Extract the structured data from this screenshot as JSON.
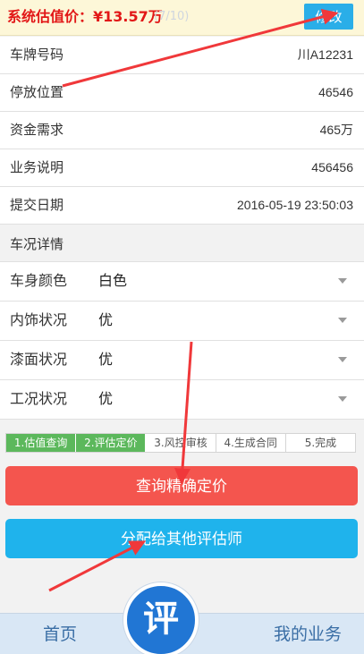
{
  "header": {
    "price_label": "系统估值价：¥13.57万",
    "hint_text": "(7/10)",
    "edit_button": "修改"
  },
  "info": [
    {
      "label": "车牌号码",
      "value": "川A12231"
    },
    {
      "label": "停放位置",
      "value": "46546"
    },
    {
      "label": "资金需求",
      "value": "465万"
    },
    {
      "label": "业务说明",
      "value": "456456"
    },
    {
      "label": "提交日期",
      "value": "2016-05-19 23:50:03"
    }
  ],
  "section": {
    "title": "车况详情"
  },
  "selects": [
    {
      "label": "车身颜色",
      "selected": "白色"
    },
    {
      "label": "内饰状况",
      "selected": "优"
    },
    {
      "label": "漆面状况",
      "selected": "优"
    },
    {
      "label": "工况状况",
      "selected": "优"
    }
  ],
  "steps": [
    {
      "label": "1.估值查询",
      "status": "done"
    },
    {
      "label": "2.评估定价",
      "status": "done"
    },
    {
      "label": "3.风控审核",
      "status": "pending"
    },
    {
      "label": "4.生成合同",
      "status": "pending"
    },
    {
      "label": "5.完成",
      "status": "pending"
    }
  ],
  "buttons": {
    "primary": "查询精确定价",
    "assign": "分配给其他评估师"
  },
  "nav": {
    "home": "首页",
    "center": "评",
    "mine": "我的业务"
  },
  "colors": {
    "price": "#e21717",
    "edit_button": "#2aaee8",
    "step_done": "#5cb85c",
    "primary_button": "#f4554e",
    "assign_button": "#1fb3ec",
    "nav_center": "#2176d4",
    "annotation_arrow": "#f0383a"
  }
}
